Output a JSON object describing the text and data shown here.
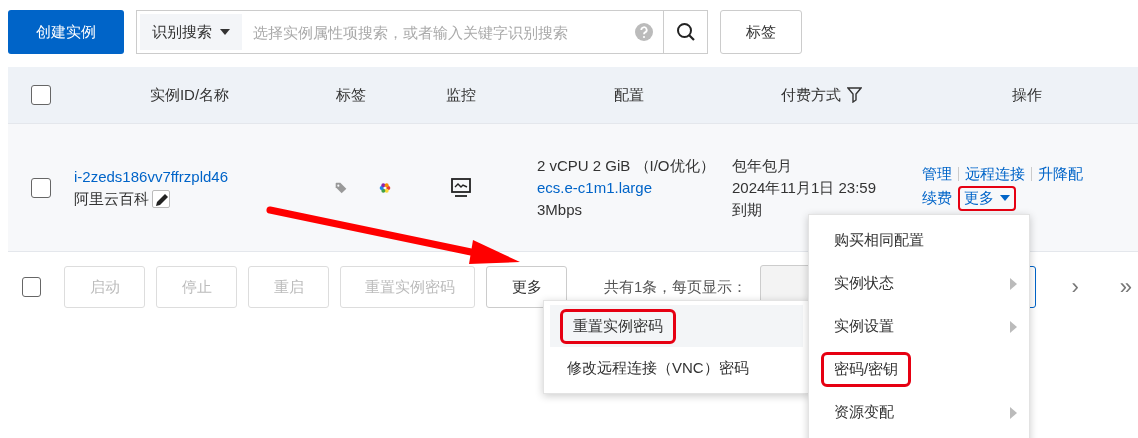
{
  "toolbar": {
    "create_button": "创建实例",
    "search": {
      "filter_label": "识别搜索",
      "placeholder": "选择实例属性项搜索，或者输入关键字识别搜索"
    },
    "tag_button": "标签"
  },
  "table": {
    "select_all": {
      "checked": false
    },
    "columns": [
      {
        "label": "实例ID/名称",
        "filter": false
      },
      {
        "label": "标签",
        "filter": false
      },
      {
        "label": "监控",
        "filter": false
      },
      {
        "label": "配置",
        "filter": false
      },
      {
        "label": "付费方式",
        "filter": true
      },
      {
        "label": "操作",
        "filter": false
      }
    ],
    "rows": [
      {
        "checked": false,
        "id": "i-2zeds186vv7ffrzpld46",
        "name": "阿里云百科",
        "config": "2 vCPU 2 GiB （I/O优化）",
        "instance_type": "ecs.e-c1m1.large",
        "bandwidth": "3Mbps",
        "billing": [
          "包年包月",
          "2024年11月1日 23:59",
          "到期"
        ],
        "actions": [
          [
            "管理",
            "远程连接",
            "升降配"
          ],
          [
            "续费"
          ]
        ],
        "more": {
          "label": "更多",
          "highlighted": true
        }
      }
    ]
  },
  "footer": {
    "checked": false,
    "buttons": [
      {
        "label": "启动",
        "disabled": true
      },
      {
        "label": "停止",
        "disabled": true
      },
      {
        "label": "重启",
        "disabled": true
      },
      {
        "label": "重置实例密码",
        "disabled": true
      }
    ],
    "more_button": "更多",
    "pagination_text": "共有1条，每页显示：",
    "next": "›",
    "last": "»"
  },
  "batch_more_menu": [
    {
      "label": "重置实例密码",
      "hovered": true,
      "highlighted": true
    },
    {
      "label": "修改远程连接（VNC）密码",
      "hovered": false,
      "highlighted": false
    }
  ],
  "row_more_menu": [
    {
      "label": "购买相同配置",
      "submenu": false,
      "highlighted": false
    },
    {
      "label": "实例状态",
      "submenu": true,
      "highlighted": false
    },
    {
      "label": "实例设置",
      "submenu": true,
      "highlighted": false
    },
    {
      "label": "密码/密钥",
      "submenu": false,
      "highlighted": true
    },
    {
      "label": "资源变配",
      "submenu": true,
      "highlighted": false
    }
  ]
}
